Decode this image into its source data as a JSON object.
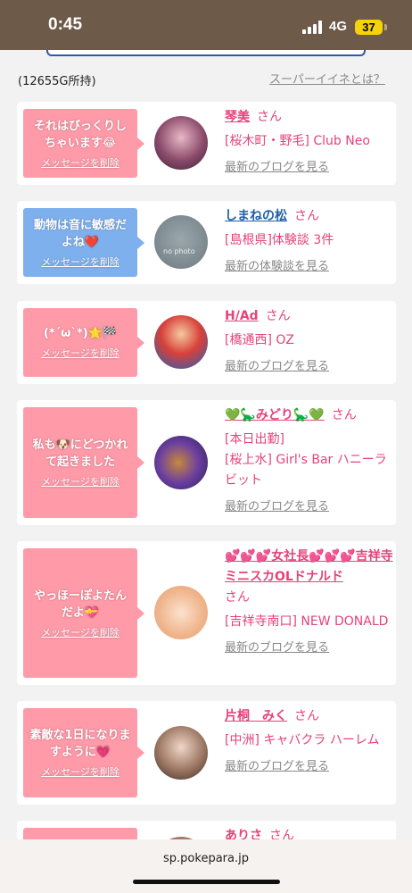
{
  "status_bar": {
    "time": "0:45",
    "network": "4G",
    "battery": "37"
  },
  "header": {
    "holdings": "(12655G所持)",
    "super_link": "スーパーイイネとは？"
  },
  "cards": [
    {
      "message": "それはびっくりしちゃいます😂",
      "delete": "メッセージを削除",
      "name": "琴美",
      "san": "さん",
      "loc1": "[桜木町・野毛] Club Neo",
      "loc2": "",
      "blog": "最新のブログを見る"
    },
    {
      "message": "動物は音に敏感だよね❤️",
      "delete": "メッセージを削除",
      "name": "しまねの松",
      "san": "さん",
      "loc1": "[島根県]体験談 3件",
      "loc2": "",
      "blog": "最新の体験談を見る",
      "avatar_text": "no photo"
    },
    {
      "message": "(*´ω`*)🌟🏁",
      "delete": "メッセージを削除",
      "name": "H/Ad",
      "san": "さん",
      "loc1": "[橋通西] OZ",
      "loc2": "",
      "blog": "最新のブログを見る"
    },
    {
      "message": "私も🐶にどつかれて起きました",
      "delete": "メッセージを削除",
      "name": "💚🦕みどり🦕💚",
      "san": "さん",
      "loc1": "[本日出勤]",
      "loc2": "[桜上水] Girl's Bar ハニーラビット",
      "blog": "最新のブログを見る"
    },
    {
      "message": "やっほーぽよたんだよ💝",
      "delete": "メッセージを削除",
      "name": "💕💕💕女社長💕💕💕吉祥寺ミニスカOLドナルド",
      "san": "さん",
      "loc1": "[吉祥寺南口] NEW DONALD",
      "loc2": "",
      "blog": "最新のブログを見る"
    },
    {
      "message": "素敵な1日になりますように💗",
      "delete": "メッセージを削除",
      "name": "片桐　みく",
      "san": "さん",
      "loc1": "[中洲] キャバクラ ハーレム",
      "loc2": "",
      "blog": "最新のブログを見る"
    },
    {
      "message": "",
      "delete": "",
      "name": "ありさ",
      "san": "さん",
      "loc1": "",
      "loc2": "",
      "blog": ""
    }
  ],
  "browser": {
    "url": "sp.pokepara.jp"
  },
  "colors": {
    "status_bar": "#6e5a48",
    "pink_bubble": "#ff9aa9",
    "blue_bubble": "#7fb0ee",
    "name_pink": "#e6427a",
    "name_blue": "#1f5fa8",
    "battery": "#f5d20b"
  },
  "icons": [
    "signal-icon",
    "battery-icon"
  ]
}
